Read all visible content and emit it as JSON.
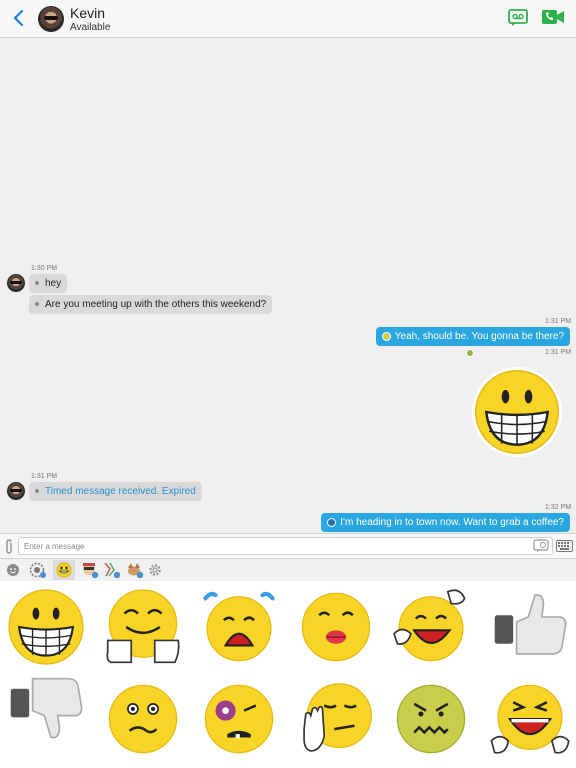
{
  "header": {
    "contact_name": "Kevin",
    "status": "Available",
    "icons": [
      "back-chevron-icon",
      "video-message-icon",
      "video-call-icon"
    ],
    "accent_color": "#1c7fe0",
    "action_color": "#2bb24c"
  },
  "conversation": {
    "messages": [
      {
        "direction": "incoming",
        "time": "1:30 PM",
        "text": "hey"
      },
      {
        "direction": "incoming",
        "text": "Are you meeting up with the others this weekend?"
      },
      {
        "direction": "outgoing",
        "time": "1:31 PM",
        "text": "Yeah, should be. You gonna be there?"
      },
      {
        "direction": "outgoing",
        "time": "1:31 PM",
        "sticker": "big-grin-sticker"
      },
      {
        "direction": "incoming",
        "time": "1:31 PM",
        "text": "Timed message received. Expired"
      },
      {
        "direction": "outgoing",
        "time": "1:32 PM",
        "text": "I'm heading in to town now. Want to grab a coffee?"
      }
    ],
    "outgoing_color": "#2aa7e0",
    "incoming_color": "#d9d9d9"
  },
  "composer": {
    "placeholder": "Enter a message",
    "icons": [
      "attachment-icon",
      "timed-message-icon",
      "keyboard-icon"
    ]
  },
  "sticker_tabs": [
    "emoji-tab",
    "recent-tab",
    "smiley-pack-tab",
    "cool-pack-tab",
    "party-pack-tab",
    "animal-pack-tab",
    "settings-tab"
  ],
  "selected_tab": "smiley-pack-tab",
  "stickers": [
    "big-grin",
    "happy-hands",
    "crying",
    "kiss",
    "laugh-wave",
    "thumbs-up",
    "thumbs-down",
    "confused",
    "black-eye",
    "meh-hand",
    "angry",
    "laughing-tears"
  ]
}
